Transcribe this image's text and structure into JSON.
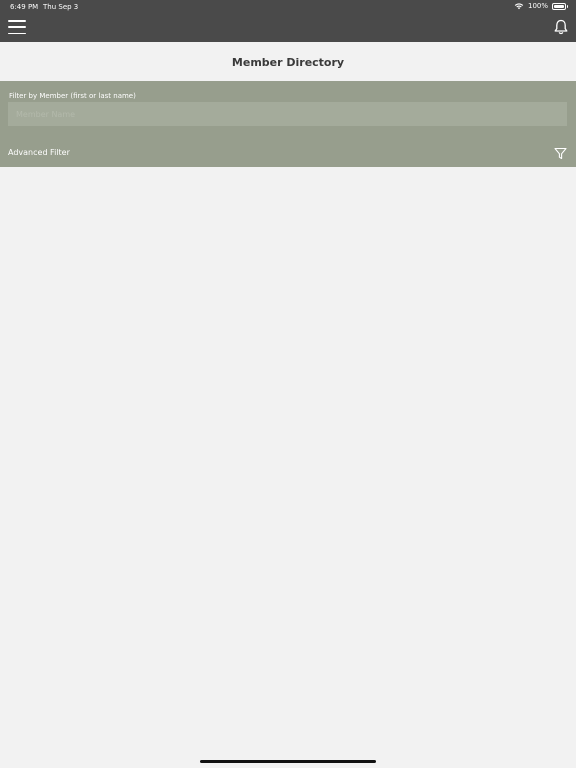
{
  "status_bar": {
    "time": "6:49 PM",
    "date": "Thu Sep 3",
    "battery_text": "100%",
    "battery_level": 1.0
  },
  "nav_bar": {
    "menu_icon": "hamburger-menu-icon",
    "notification_icon": "bell-icon"
  },
  "page": {
    "title": "Member Directory"
  },
  "filter": {
    "member_label": "Filter by Member (first or last name)",
    "member_value": "",
    "member_placeholder": "Member Name",
    "advanced_label": "Advanced Filter",
    "advanced_icon": "funnel-filter-icon"
  },
  "colors": {
    "nav_background": "#4a4a4a",
    "filter_background": "#979e8d",
    "page_background": "#f2f2f2"
  },
  "members": []
}
